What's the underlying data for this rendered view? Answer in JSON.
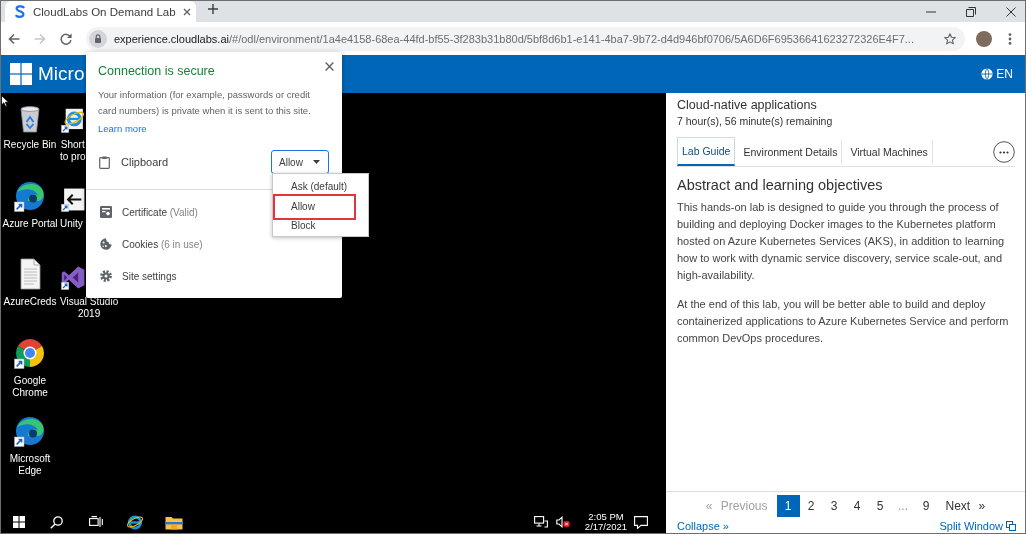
{
  "browser": {
    "tab": {
      "title": "CloudLabs On Demand Lab"
    },
    "forward": {
      "disabled": true
    },
    "address": {
      "host": "experience.cloudlabs.ai",
      "path": "/#/odl/environment/1a4e4158-68ea-44fd-bf55-3f283b31b80d/5bf8d6b1-e141-4ba7-9b72-d4d946bf0706/5A6D6F69536641623272326E4F7..."
    }
  },
  "header": {
    "brand": "Micro",
    "language": "EN"
  },
  "site_info_popup": {
    "title": "Connection is secure",
    "description": "Your information (for example, passwords or credit card numbers) is private when it is sent to this site.",
    "link": "Learn more",
    "permission": {
      "label": "Clipboard",
      "value": "Allow",
      "expanded": true,
      "options": [
        {
          "label": "Ask (default)",
          "highlighted": false
        },
        {
          "label": "Allow",
          "highlighted": true
        },
        {
          "label": "Block",
          "highlighted": false
        }
      ]
    },
    "items": [
      {
        "kind": "certificate",
        "label": "Certificate",
        "detail": "(Valid)"
      },
      {
        "kind": "cookies",
        "label": "Cookies",
        "detail": "(6 in use)"
      },
      {
        "kind": "settings",
        "label": "Site settings"
      }
    ]
  },
  "desktop": {
    "icon_columns": [
      {
        "icons": [
          {
            "kind": "recycle-bin",
            "label": "Recycle Bin",
            "shortcut": false
          },
          {
            "kind": "wave-browser",
            "label": "Azure Portal",
            "shortcut": true
          },
          {
            "kind": "document",
            "label": "AzureCreds",
            "shortcut": false
          },
          {
            "kind": "ring-browser",
            "label": "Google\nChrome",
            "shortcut": true
          },
          {
            "kind": "wave-browser",
            "label": "Microsoft\nEdge",
            "shortcut": true
          }
        ]
      },
      {
        "icons": [
          {
            "kind": "browser-e",
            "label": "Short\nto pro",
            "shortcut": true
          },
          {
            "kind": "arrow-tile",
            "label": "Unity",
            "shortcut": true
          },
          {
            "kind": "ide",
            "label": "Visual Studio\n2019",
            "shortcut": true
          }
        ]
      }
    ],
    "taskbar": {
      "time": "2:05 PM",
      "date": "2/17/2021"
    }
  },
  "lab_panel": {
    "title": "Cloud-native applications",
    "time_remaining": "7 hour(s), 56 minute(s) remaining",
    "tabs": [
      {
        "label": "Lab Guide",
        "selected": true
      },
      {
        "label": "Environment Details",
        "selected": false
      },
      {
        "label": "Virtual Machines",
        "selected": false
      }
    ],
    "heading": "Abstract and learning objectives",
    "paragraphs": [
      "This hands-on lab is designed to guide you through the process of building and deploying Docker images to the Kubernetes platform hosted on Azure Kubernetes Services (AKS), in addition to learning how to work with dynamic service discovery, service scale-out, and high-availability.",
      "At the end of this lab, you will be better able to build and deploy containerized applications to Azure Kubernetes Service and perform common DevOps procedures."
    ],
    "pagination": {
      "previous": {
        "label": "« Previous",
        "disabled": true
      },
      "pages": [
        {
          "kind": "page",
          "label": "1",
          "selected": true
        },
        {
          "kind": "page",
          "label": "2",
          "selected": false
        },
        {
          "kind": "page",
          "label": "3",
          "selected": false
        },
        {
          "kind": "page",
          "label": "4",
          "selected": false
        },
        {
          "kind": "page",
          "label": "5",
          "selected": false
        },
        {
          "kind": "gap",
          "label": "...",
          "selected": false
        },
        {
          "kind": "page",
          "label": "9",
          "selected": false
        }
      ],
      "next": {
        "label": "Next »",
        "disabled": false
      }
    },
    "footer": {
      "collapse": "Collapse »",
      "split_window": "Split Window"
    }
  }
}
